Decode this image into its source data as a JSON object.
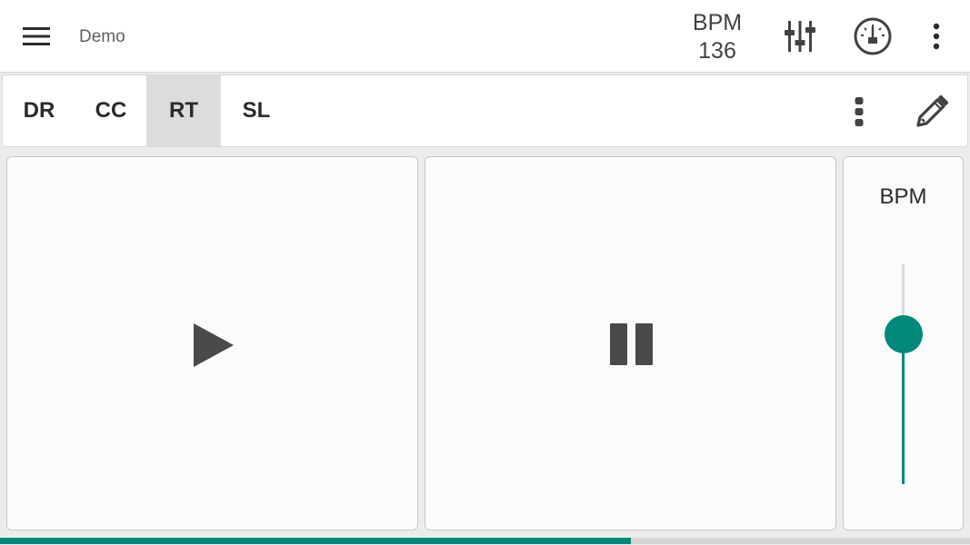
{
  "appbar": {
    "title": "Demo",
    "bpm_label": "BPM",
    "bpm_value": "136",
    "icons": [
      "menu-icon",
      "mixer-sliders-icon",
      "gauge-icon",
      "more-vert-icon"
    ]
  },
  "tabs": {
    "items": [
      {
        "label": "DR"
      },
      {
        "label": "CC"
      },
      {
        "label": "RT"
      },
      {
        "label": "SL"
      }
    ],
    "active_index": 2,
    "icons": [
      "more-vert-icon",
      "pencil-icon"
    ]
  },
  "panels": {
    "play_icon": "play-icon",
    "pause_icon": "pause-icon",
    "slider": {
      "label": "BPM",
      "level": 0.68
    }
  },
  "progress": {
    "fraction": 0.65
  },
  "colors": {
    "accent": "#00897b",
    "icon": "#424242",
    "active_tab_bg": "#dcdcdc"
  }
}
